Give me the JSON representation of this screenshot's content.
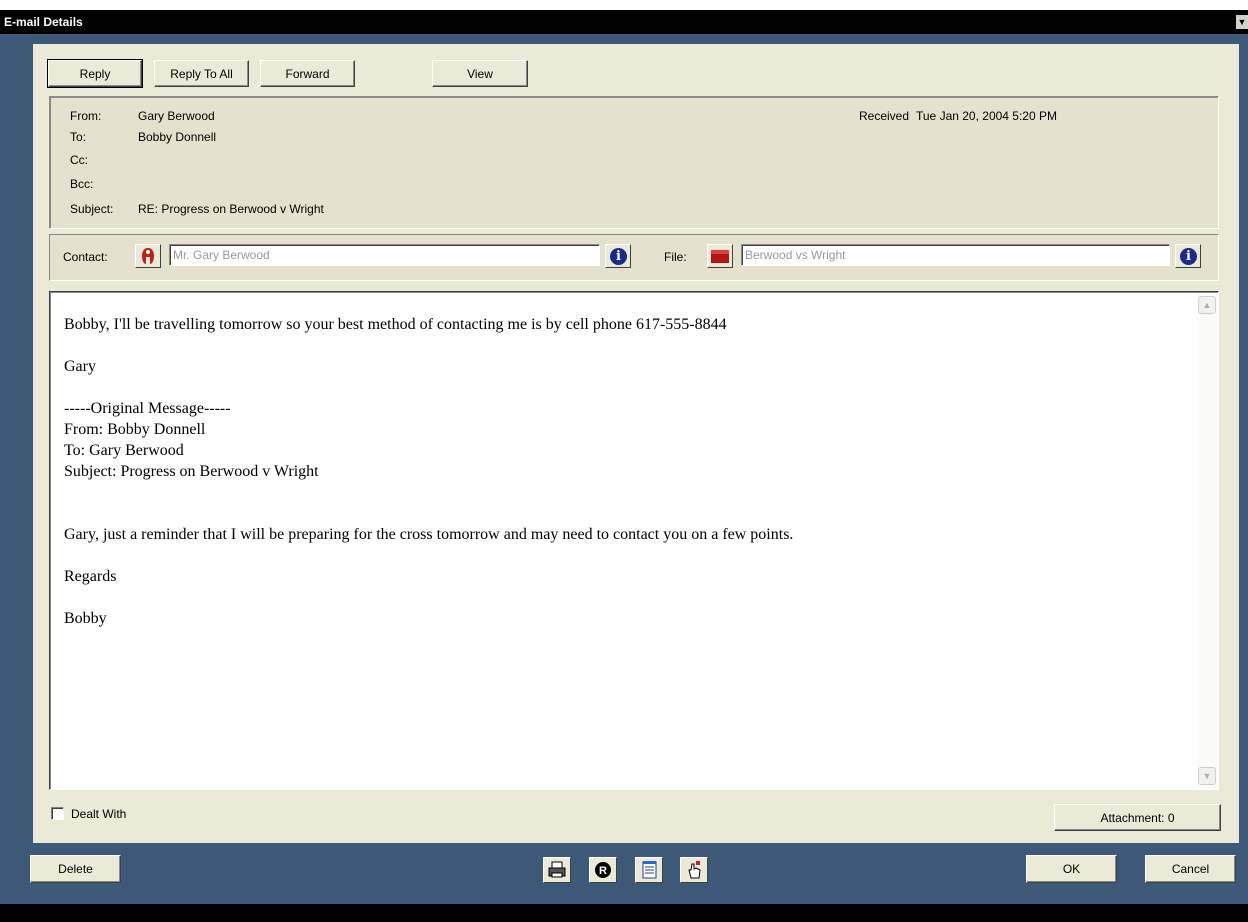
{
  "window": {
    "title": "E-mail Details"
  },
  "toolbar": {
    "reply_label": "Reply",
    "reply_all_label": "Reply To All",
    "forward_label": "Forward",
    "view_label": "View"
  },
  "header": {
    "from_label": "From:",
    "from_value": "Gary Berwood",
    "to_label": "To:",
    "to_value": "Bobby Donnell",
    "cc_label": "Cc:",
    "cc_value": "",
    "bcc_label": "Bcc:",
    "bcc_value": "",
    "subject_label": "Subject:",
    "subject_value": "RE: Progress on Berwood v Wright",
    "received_label": "Received",
    "received_value": "Tue Jan 20, 2004  5:20 PM"
  },
  "contact": {
    "label": "Contact:",
    "value": "Mr. Gary Berwood",
    "icon": "contact-person-icon"
  },
  "file": {
    "label": "File:",
    "value": "Berwood vs Wright",
    "icon": "file-folder-icon"
  },
  "body": {
    "lines": [
      "Bobby, I'll be travelling tomorrow so your best method of contacting me is by cell phone 617-555-8844",
      "",
      "Gary",
      "",
      "-----Original Message-----",
      "From: Bobby Donnell",
      "To: Gary Berwood",
      "Subject: Progress on Berwood v Wright",
      "",
      "",
      "Gary, just a reminder that I will be preparing for the cross tomorrow and may need to contact you on a few points.",
      "",
      "Regards",
      "",
      "Bobby"
    ]
  },
  "dealt_with": {
    "label": "Dealt With",
    "checked": false
  },
  "attachment": {
    "label": "Attachment: 0"
  },
  "footer": {
    "delete_label": "Delete",
    "ok_label": "OK",
    "cancel_label": "Cancel",
    "icons": [
      "print-icon",
      "record-icon",
      "notepad-icon",
      "hand-pointer-icon"
    ]
  },
  "colors": {
    "frame": "#3e5978",
    "panel": "#ebe9d7",
    "info_icon": "#1a2c88"
  }
}
